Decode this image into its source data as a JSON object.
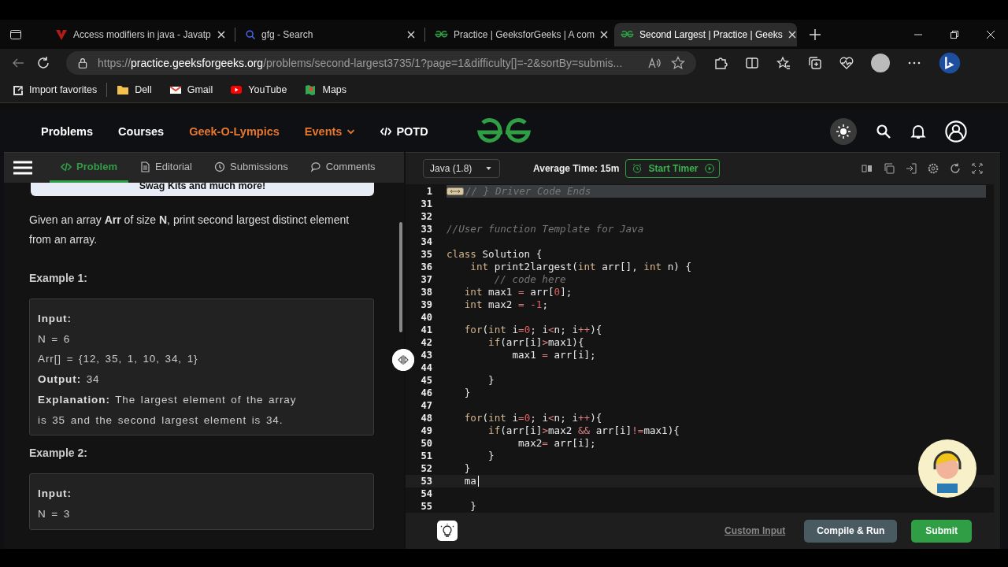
{
  "browser": {
    "tabs": [
      {
        "title": "Access modifiers in java - Javatp",
        "selected": false
      },
      {
        "title": "gfg - Search",
        "selected": false
      },
      {
        "title": "Practice | GeeksforGeeks | A com",
        "selected": false
      },
      {
        "title": "Second Largest | Practice | Geeks",
        "selected": true
      }
    ],
    "url": "https://**practice.geeksforgeeks.org**/problems/second-largest3735/1?page=1&difficulty[]=-2&sortBy=submis...",
    "favorites": [
      "Import favorites",
      "Dell",
      "Gmail",
      "YouTube",
      "Maps"
    ]
  },
  "site_nav": [
    {
      "label": "Problems",
      "color": "#ffffff",
      "dropdown": false,
      "code_icon": false
    },
    {
      "label": "Courses",
      "color": "#ffffff",
      "dropdown": false,
      "code_icon": false
    },
    {
      "label": "Geek-O-Lympics",
      "color": "#e8772e",
      "dropdown": false,
      "code_icon": false
    },
    {
      "label": "Events",
      "color": "#e8772e",
      "dropdown": true,
      "code_icon": false
    },
    {
      "label": "POTD",
      "color": "#ffffff",
      "dropdown": false,
      "code_icon": true
    }
  ],
  "problem_tabs": [
    {
      "label": "Problem",
      "selected": true
    },
    {
      "label": "Editorial",
      "selected": false
    },
    {
      "label": "Submissions",
      "selected": false
    },
    {
      "label": "Comments",
      "selected": false
    }
  ],
  "banner": "Swag Kits and much more!",
  "description": "Given an array **Arr** of size **N**, print second largest distinct element from an array.",
  "examples": [
    {
      "heading": "Example 1:",
      "lines": [
        "**Input:**",
        "N = 6",
        "Arr[] = {12, 35, 1, 10, 34, 1}",
        "**Output:** 34",
        "**Explanation:** The largest element of the array is 35 and the second largest element is 34."
      ]
    },
    {
      "heading": "Example 2:",
      "lines": [
        "**Input:**",
        "N = 3"
      ]
    }
  ],
  "editor": {
    "language": "Java (1.8)",
    "average_time": "Average Time: 15m",
    "timer_button": "Start Timer",
    "lines": [
      {
        "number": "1",
        "code": "// } Driver Code Ends",
        "kind": "comment",
        "folded": true,
        "active": false
      },
      {
        "number": "31",
        "folded": false,
        "active": false
      },
      {
        "number": "32",
        "folded": false,
        "active": false
      },
      {
        "number": "33",
        "code": "//User function Template for Java",
        "kind": "comment",
        "folded": false,
        "active": false
      },
      {
        "number": "34",
        "folded": false,
        "active": false
      },
      {
        "number": "35",
        "code": "class Solution {",
        "kind": "code",
        "folded": false,
        "active": false
      },
      {
        "number": "36",
        "code": "    int print2largest(int arr[], int n) {",
        "kind": "code",
        "folded": false,
        "active": false
      },
      {
        "number": "37",
        "code": "        // code here",
        "kind": "comment",
        "folded": false,
        "active": false
      },
      {
        "number": "38",
        "code": "   int max1 = arr[0];",
        "kind": "code",
        "folded": false,
        "active": false
      },
      {
        "number": "39",
        "code": "   int max2 = -1;",
        "kind": "code",
        "folded": false,
        "active": false
      },
      {
        "number": "40",
        "folded": false,
        "active": false
      },
      {
        "number": "41",
        "code": "   for(int i=0; i<n; i++){",
        "kind": "code",
        "folded": false,
        "active": false
      },
      {
        "number": "42",
        "code": "       if(arr[i]>max1){",
        "kind": "code",
        "folded": false,
        "active": false
      },
      {
        "number": "43",
        "code": "           max1 = arr[i];",
        "kind": "code",
        "folded": false,
        "active": false
      },
      {
        "number": "44",
        "folded": false,
        "active": false
      },
      {
        "number": "45",
        "code": "       }",
        "kind": "code",
        "folded": false,
        "active": false
      },
      {
        "number": "46",
        "code": "   }",
        "kind": "code",
        "folded": false,
        "active": false
      },
      {
        "number": "47",
        "folded": false,
        "active": false
      },
      {
        "number": "48",
        "code": "   for(int i=0; i<n; i++){",
        "kind": "code",
        "folded": false,
        "active": false
      },
      {
        "number": "49",
        "code": "       if(arr[i]>max2 && arr[i]!=max1){",
        "kind": "code",
        "folded": false,
        "active": false
      },
      {
        "number": "50",
        "code": "            max2= arr[i];",
        "kind": "code",
        "folded": false,
        "active": false
      },
      {
        "number": "51",
        "code": "       }",
        "kind": "code",
        "folded": false,
        "active": false
      },
      {
        "number": "52",
        "code": "   }",
        "kind": "code",
        "folded": false,
        "active": false
      },
      {
        "number": "53",
        "code": "   ma",
        "kind": "code",
        "folded": false,
        "active": true
      },
      {
        "number": "54",
        "folded": false,
        "active": false
      },
      {
        "number": "55",
        "code": "    }",
        "kind": "code",
        "folded": false,
        "active": false
      }
    ],
    "custom_input": "Custom Input",
    "compile_button": "Compile & Run",
    "submit_button": "Submit"
  }
}
